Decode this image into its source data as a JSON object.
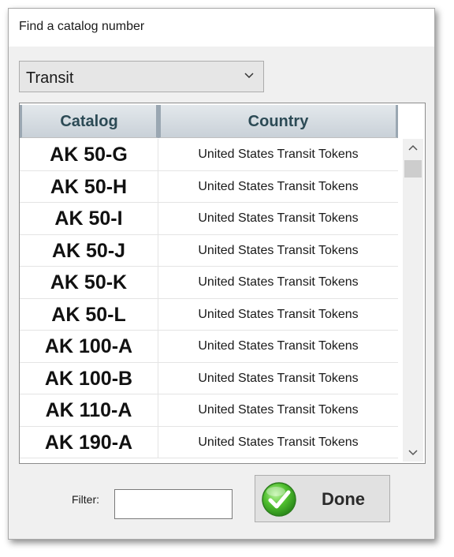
{
  "dialog": {
    "title": "Find a catalog number"
  },
  "category_select": {
    "value": "Transit"
  },
  "grid": {
    "columns": [
      "Catalog",
      "Country"
    ],
    "rows": [
      {
        "catalog": "AK 50-G",
        "country": "United States Transit Tokens"
      },
      {
        "catalog": "AK 50-H",
        "country": "United States Transit Tokens"
      },
      {
        "catalog": "AK 50-I",
        "country": "United States Transit Tokens"
      },
      {
        "catalog": "AK 50-J",
        "country": "United States Transit Tokens"
      },
      {
        "catalog": "AK 50-K",
        "country": "United States Transit Tokens"
      },
      {
        "catalog": "AK 50-L",
        "country": "United States Transit Tokens"
      },
      {
        "catalog": "AK 100-A",
        "country": "United States Transit Tokens"
      },
      {
        "catalog": "AK 100-B",
        "country": "United States Transit Tokens"
      },
      {
        "catalog": "AK 110-A",
        "country": "United States Transit Tokens"
      },
      {
        "catalog": "AK 190-A",
        "country": "United States Transit Tokens"
      }
    ]
  },
  "filter": {
    "label": "Filter:",
    "value": ""
  },
  "buttons": {
    "done_label": "Done"
  },
  "icons": {
    "dropdown": "chevron-down-icon",
    "done": "check-icon",
    "scroll_up": "chevron-up-icon",
    "scroll_down": "chevron-down-icon"
  },
  "colors": {
    "header_text": "#2c4a55",
    "check_green": "#3aa82a"
  }
}
